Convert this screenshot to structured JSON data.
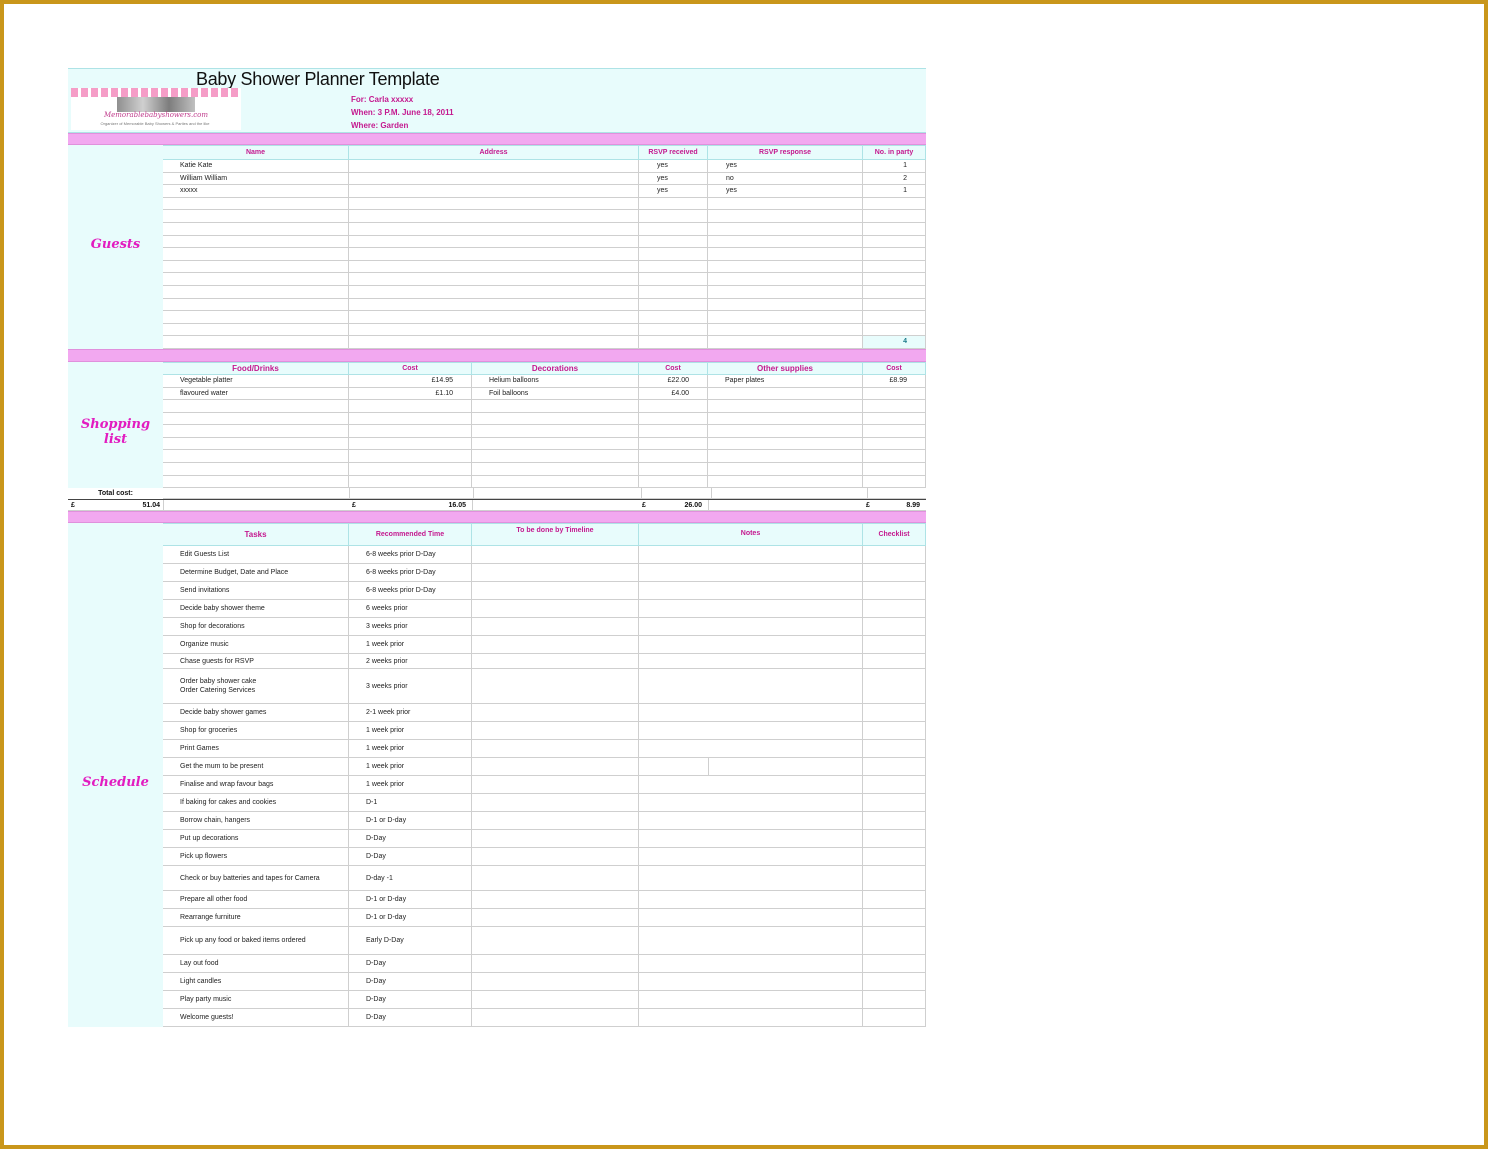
{
  "title": "Baby Shower Planner Template",
  "logo": {
    "brand": "Memorablebabyshowers.com",
    "tagline": "Organizer of Memorable Baby Showers & Parties and the like"
  },
  "event": {
    "for": "For: Carla xxxxx",
    "when": "When:  3 P.M. June 18, 2011",
    "where": "Where: Garden"
  },
  "guests": {
    "label": "Guests",
    "headers": [
      "Name",
      "Address",
      "RSVP received",
      "RSVP response",
      "No. in party"
    ],
    "rows": [
      [
        "Katie Kate",
        "",
        "yes",
        "yes",
        "1"
      ],
      [
        "William William",
        "",
        "yes",
        "no",
        "2"
      ],
      [
        "xxxxx",
        "",
        "yes",
        "yes",
        "1"
      ]
    ],
    "total": "4"
  },
  "shopping": {
    "label": "Shopping list",
    "headers": [
      "Food/Drinks",
      "Cost",
      "Decorations",
      "Cost",
      "Other supplies",
      "Cost"
    ],
    "rows": [
      [
        "Vegetable platter",
        "£14.95",
        "Helium balloons",
        "£22.00",
        "Paper plates",
        "£8.99"
      ],
      [
        " flavoured  water",
        "£1.10",
        "Foil balloons",
        "£4.00",
        "",
        ""
      ]
    ],
    "total_label": "Total cost:",
    "currency": "£",
    "grand_total": "51.04",
    "food_total": "16.05",
    "decor_total": "26.00",
    "other_total": "8.99"
  },
  "schedule": {
    "label": "Schedule",
    "headers": [
      "Tasks",
      "Recommended Time",
      "To be done by Timeline",
      "Notes",
      "Checklist"
    ],
    "rows": [
      [
        "Edit Guests List",
        "6-8 weeks prior D-Day"
      ],
      [
        "Determine Budget, Date and Place",
        "6-8 weeks prior D-Day"
      ],
      [
        "Send invitations",
        "6-8 weeks prior D-Day"
      ],
      [
        "Decide baby shower theme",
        "6 weeks prior"
      ],
      [
        "Shop for decorations",
        "3 weeks prior"
      ],
      [
        "Organize music",
        "1 week prior"
      ],
      [
        "Chase guests for RSVP",
        "2 weeks prior"
      ],
      [
        "Order baby shower cake\nOrder Catering Services",
        "3 weeks prior"
      ],
      [
        "Decide baby shower games",
        "2-1 week prior"
      ],
      [
        "Shop for groceries",
        "1 week prior"
      ],
      [
        "Print Games",
        "1 week prior"
      ],
      [
        "Get the mum to be present",
        "1 week prior"
      ],
      [
        "Finalise and wrap favour bags",
        "1 week prior"
      ],
      [
        "If baking for cakes and cookies",
        "D-1"
      ],
      [
        "Borrow chain, hangers",
        "D-1 or D-day"
      ],
      [
        "Put up decorations",
        "D-Day"
      ],
      [
        "Pick up flowers",
        "D-Day"
      ],
      [
        "Check or buy batteries and tapes for Camera",
        "D-day -1"
      ],
      [
        "Prepare all other food",
        "D-1 or D-day"
      ],
      [
        "Rearrange furniture",
        "D-1 or D-day"
      ],
      [
        "Pick up any food or baked items ordered",
        "Early D-Day"
      ],
      [
        "Lay out food",
        "D-Day"
      ],
      [
        "Light candles",
        "D-Day"
      ],
      [
        "Play party music",
        "D-Day"
      ],
      [
        "Welcome guests!",
        "D-Day"
      ]
    ]
  }
}
